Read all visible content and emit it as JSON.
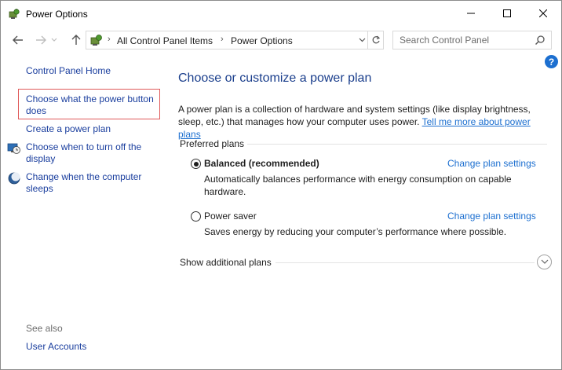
{
  "window": {
    "title": "Power Options"
  },
  "address": {
    "crumbs": [
      "All Control Panel Items",
      "Power Options"
    ]
  },
  "search": {
    "placeholder": "Search Control Panel"
  },
  "help": {
    "label": "?"
  },
  "sidebar": {
    "home": "Control Panel Home",
    "items": [
      {
        "label": "Choose what the power button does",
        "selected": true
      },
      {
        "label": "Create a power plan"
      },
      {
        "label": "Choose when to turn off the display",
        "icon": "display-schedule-icon"
      },
      {
        "label": "Change when the computer sleeps",
        "icon": "moon-sleep-icon"
      }
    ],
    "see_also_label": "See also",
    "see_also": [
      "User Accounts"
    ]
  },
  "main": {
    "heading": "Choose or customize a power plan",
    "description": "A power plan is a collection of hardware and system settings (like display brightness, sleep, etc.) that manages how your computer uses power.",
    "learn_more": "Tell me more about power plans",
    "preferred_label": "Preferred plans",
    "plans": [
      {
        "name": "Balanced (recommended)",
        "selected": true,
        "change_label": "Change plan settings",
        "description": "Automatically balances performance with energy consumption on capable hardware."
      },
      {
        "name": "Power saver",
        "selected": false,
        "change_label": "Change plan settings",
        "description": "Saves energy by reducing your computer’s performance where possible."
      }
    ],
    "additional_label": "Show additional plans"
  },
  "colors": {
    "link": "#1c6fd0",
    "heading": "#1a3e8c",
    "selection_border": "#e0595a"
  }
}
